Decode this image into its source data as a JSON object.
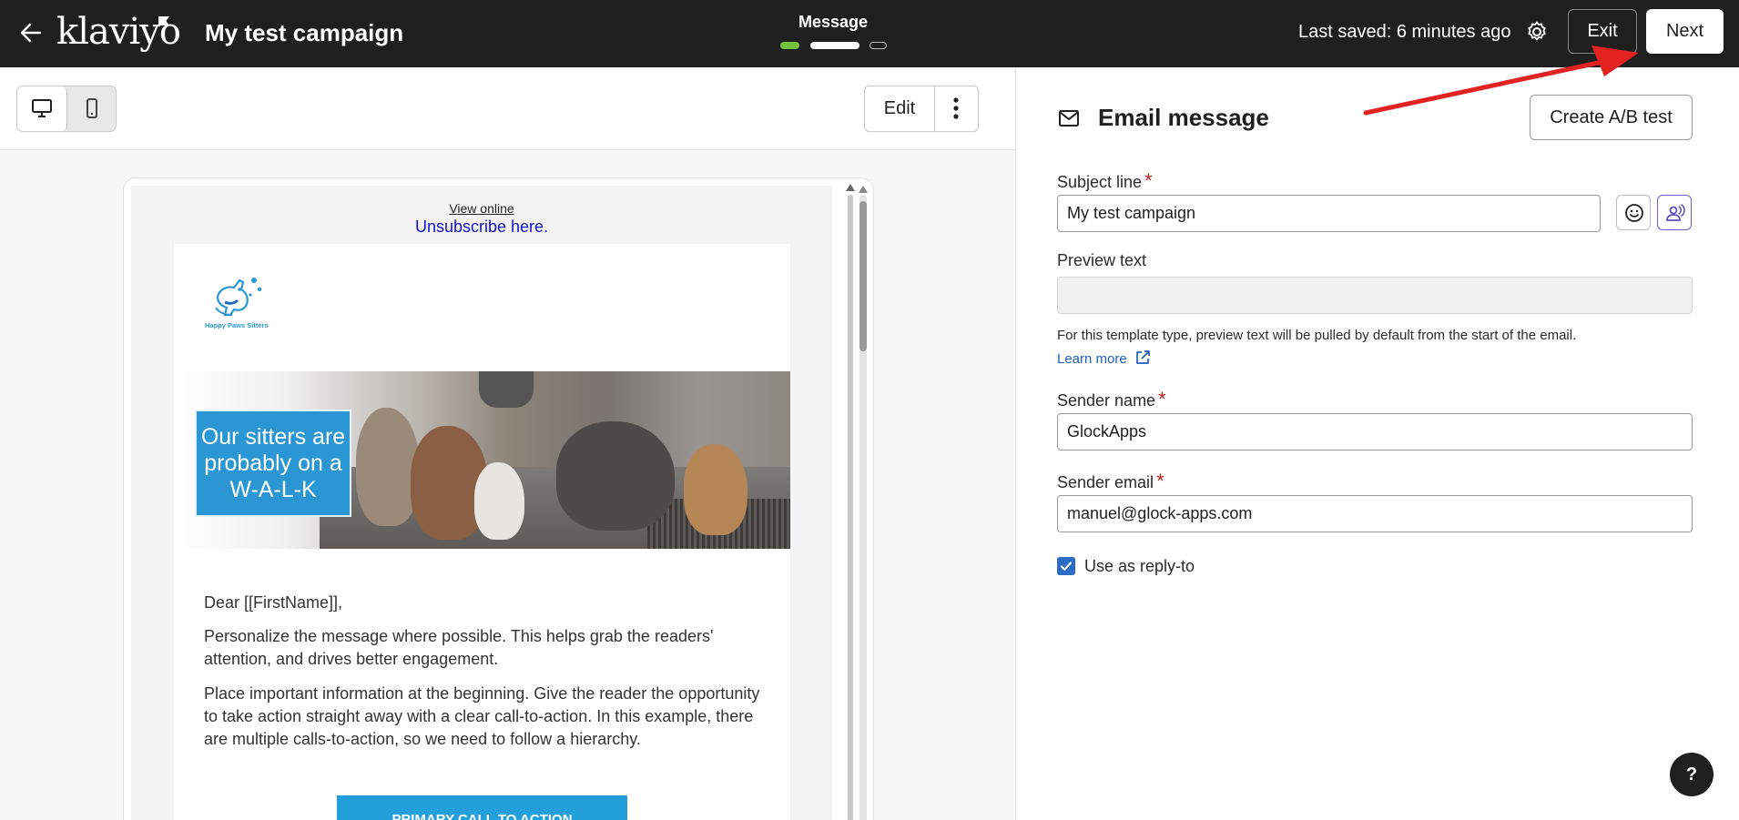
{
  "header": {
    "logo_text": "klaviyo",
    "campaign_title": "My test campaign",
    "step_label": "Message",
    "last_saved": "Last saved: 6 minutes ago",
    "exit_label": "Exit",
    "next_label": "Next"
  },
  "toolbar": {
    "edit_label": "Edit",
    "view_modes": [
      "desktop",
      "mobile"
    ],
    "selected_view": "desktop"
  },
  "preview": {
    "view_online": "View online",
    "unsubscribe": "Unsubscribe here.",
    "brand_name": "Happy Paws Sitters",
    "hero_text": "Our sitters are probably on a W-A-L-K",
    "greeting": "Dear [[FirstName]],",
    "paragraph_1": "Personalize the message where possible. This helps grab the readers' attention, and drives better engagement.",
    "paragraph_2": "Place important information at the beginning. Give the reader the opportunity to take action straight away with a clear call-to-action. In this example, there are multiple calls-to-action, so we need to follow a hierarchy.",
    "cta_label": "PRIMARY CALL TO ACTION"
  },
  "panel": {
    "heading": "Email message",
    "ab_test_label": "Create A/B test",
    "subject_label": "Subject line",
    "subject_value": "My test campaign",
    "preview_label": "Preview text",
    "preview_value": "",
    "preview_help": "For this template type, preview text will be pulled by default from the start of the email.",
    "learn_more": "Learn more",
    "sender_name_label": "Sender name",
    "sender_name_value": "GlockApps",
    "sender_email_label": "Sender email",
    "sender_email_value": "manuel@glock-apps.com",
    "reply_to_label": "Use as reply-to",
    "reply_to_checked": true,
    "required_marker": "*"
  },
  "help_button": "?",
  "colors": {
    "topbar": "#1f1f1f",
    "step_done": "#74c23b",
    "hero_box": "#2a97d4",
    "cta": "#23a0dc",
    "link": "#1a5fbf",
    "checkbox": "#2b6cc4",
    "annotation": "#e32222"
  }
}
